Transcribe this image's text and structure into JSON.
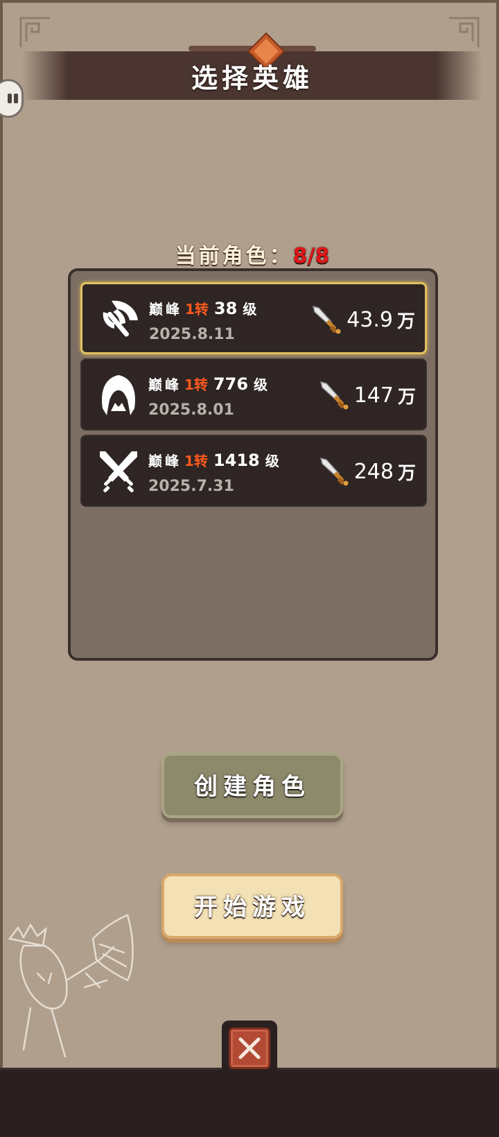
{
  "title": "选择英雄",
  "role_count": {
    "label": "当前角色：",
    "value": "8/8"
  },
  "heroes": [
    {
      "class_icon": "axe-icon",
      "peak": "巅峰",
      "turn": "1转",
      "level": "38",
      "level_unit": "级",
      "date": "2025.8.11",
      "power": "43.9",
      "power_unit": "万",
      "selected": true
    },
    {
      "class_icon": "hood-icon",
      "peak": "巅峰",
      "turn": "1转",
      "level": "776",
      "level_unit": "级",
      "date": "2025.8.01",
      "power": "147",
      "power_unit": "万",
      "selected": false
    },
    {
      "class_icon": "crossed-swords-icon",
      "peak": "巅峰",
      "turn": "1转",
      "level": "1418",
      "level_unit": "级",
      "date": "2025.7.31",
      "power": "248",
      "power_unit": "万",
      "selected": false
    }
  ],
  "buttons": {
    "create": "创建角色",
    "start": "开始游戏"
  },
  "colors": {
    "accent_red": "#e0161a",
    "turn_orange": "#ff5a1e",
    "selected_border": "#e0c060"
  }
}
